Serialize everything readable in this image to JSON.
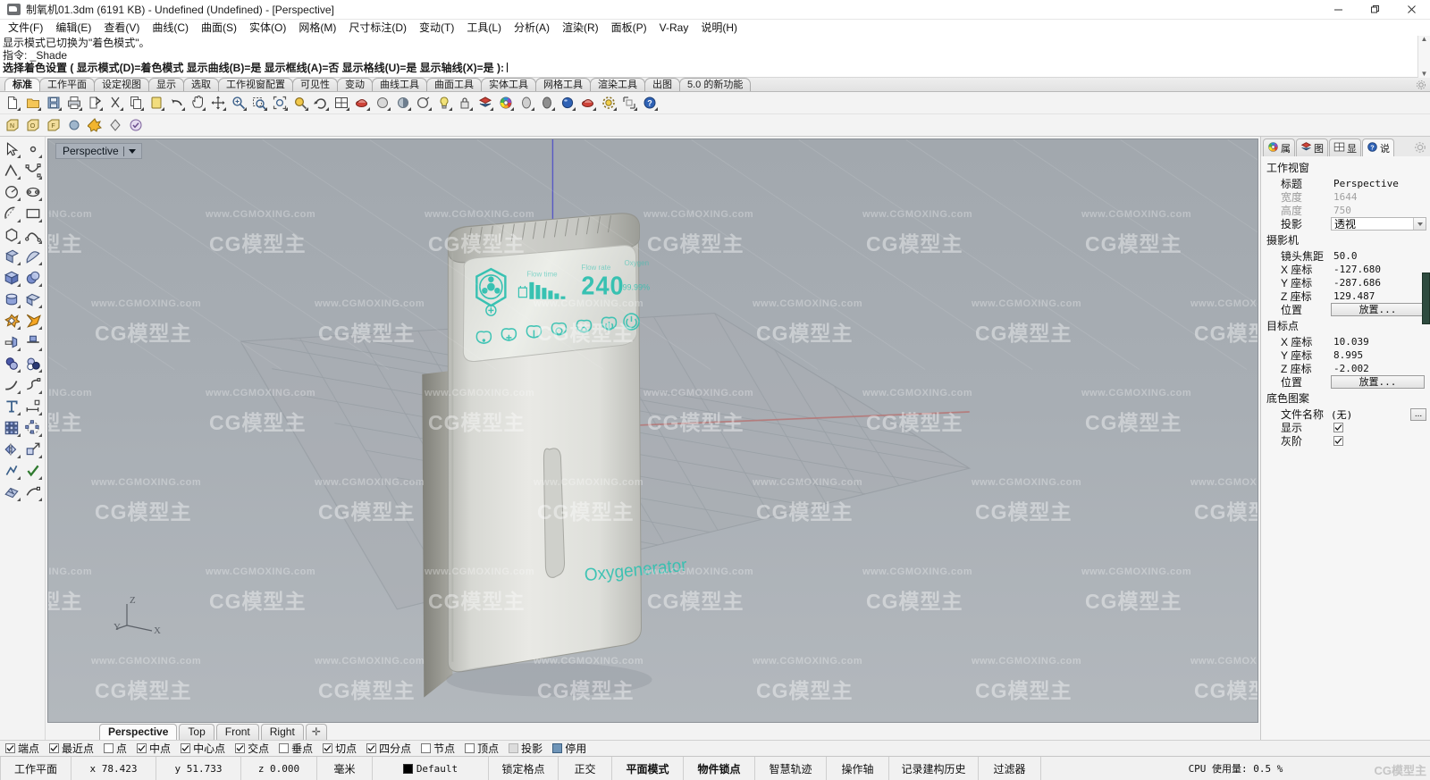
{
  "window": {
    "title": "制氧机01.3dm (6191 KB) - Undefined (Undefined) - [Perspective]",
    "minimize": "—",
    "maximize": "❐",
    "close": "✕"
  },
  "menubar": {
    "items": [
      {
        "label": "文件(F)"
      },
      {
        "label": "编辑(E)"
      },
      {
        "label": "查看(V)"
      },
      {
        "label": "曲线(C)"
      },
      {
        "label": "曲面(S)"
      },
      {
        "label": "实体(O)"
      },
      {
        "label": "网格(M)"
      },
      {
        "label": "尺寸标注(D)"
      },
      {
        "label": "变动(T)"
      },
      {
        "label": "工具(L)"
      },
      {
        "label": "分析(A)"
      },
      {
        "label": "渲染(R)"
      },
      {
        "label": "面板(P)"
      },
      {
        "label": "V-Ray"
      },
      {
        "label": "说明(H)"
      }
    ]
  },
  "command": {
    "history_1": "显示模式已切换为\"着色模式\"。",
    "history_2": "指令: _Shade",
    "prompt": "选择着色设置 ( 显示模式(D)=着色模式  显示曲线(B)=是  显示框线(A)=否  显示格线(U)=是  显示轴线(X)=是 ):",
    "scroll_up": "▲",
    "scroll_down": "▼"
  },
  "toolbar_tabs": {
    "items": [
      {
        "label": "标准",
        "active": true
      },
      {
        "label": "工作平面",
        "active": false
      },
      {
        "label": "设定视图",
        "active": false
      },
      {
        "label": "显示",
        "active": false
      },
      {
        "label": "选取",
        "active": false
      },
      {
        "label": "工作视窗配置",
        "active": false
      },
      {
        "label": "可见性",
        "active": false
      },
      {
        "label": "变动",
        "active": false
      },
      {
        "label": "曲线工具",
        "active": false
      },
      {
        "label": "曲面工具",
        "active": false
      },
      {
        "label": "实体工具",
        "active": false
      },
      {
        "label": "网格工具",
        "active": false
      },
      {
        "label": "渲染工具",
        "active": false
      },
      {
        "label": "出图",
        "active": false
      },
      {
        "label": "5.0 的新功能",
        "active": false
      }
    ]
  },
  "standard_toolbar": {
    "icons": [
      "new-file-icon",
      "open-folder-icon",
      "save-icon",
      "print-icon",
      "export-icon",
      "cut-icon",
      "copy-icon",
      "paste-icon",
      "undo-icon",
      "pan-icon",
      "move-icon",
      "zoom-icon",
      "zoom-window-icon",
      "zoom-extents-icon",
      "zoom-selected-icon",
      "rotate-view-icon",
      "viewport-layout-icon",
      "render-icon",
      "render-preview-icon",
      "shade-icon",
      "properties-icon",
      "light-icon",
      "lock-layer-icon",
      "layer-icon",
      "color-wheel-icon",
      "material-grey-icon",
      "material-dark-icon",
      "material-blue-icon",
      "vray-render-icon",
      "vray-options-icon",
      "vray-frame-icon",
      "help-icon"
    ]
  },
  "secondary_toolbar": {
    "icons": [
      "osnap-n-icon",
      "osnap-o-icon",
      "osnap-f-icon",
      "sphere-icon",
      "explode-icon",
      "diamond-icon",
      "check-circle-icon"
    ]
  },
  "left_palette": {
    "icons": [
      "select-arrow-icon",
      "point-icon",
      "polyline-icon",
      "control-point-curve-icon",
      "circle-icon",
      "ellipse-icon",
      "arc-icon",
      "rectangle-icon",
      "polygon-icon",
      "freeform-curve-icon",
      "surface-from-points-icon",
      "surface-sweep-icon",
      "box-icon",
      "sphere-solid-icon",
      "cylinder-icon",
      "extrude-surface-icon",
      "boolean-union-icon",
      "boolean-difference-icon",
      "trim-icon",
      "split-icon",
      "boolean-sphere-icon",
      "boolean-two-sphere-icon",
      "fillet-curve-icon",
      "blend-curve-icon",
      "text-icon",
      "dimension-icon",
      "array-icon",
      "array-polar-icon",
      "mirror-icon",
      "scale-icon",
      "analyze-icon",
      "check-icon",
      "render-mesh-icon",
      "mesh-tools-icon"
    ]
  },
  "viewport": {
    "label": "Perspective",
    "caret": "▼",
    "axis": {
      "x": "X",
      "y": "Y",
      "z": "Z"
    },
    "model": {
      "brand_text": "Oxygenerator",
      "display_value": "240",
      "display_label_left": "Flow time",
      "display_label_mid": "Flow rate",
      "display_label_right": "Oxygen",
      "display_sub_right": "99.99%",
      "accent_color": "#2fc0b0"
    },
    "tabs": [
      {
        "label": "Perspective",
        "active": true
      },
      {
        "label": "Top",
        "active": false
      },
      {
        "label": "Front",
        "active": false
      },
      {
        "label": "Right",
        "active": false
      },
      {
        "label": "✛",
        "active": false
      }
    ]
  },
  "properties_panel": {
    "tabs": [
      {
        "icon": "color-wheel-icon",
        "label": "属",
        "active": false
      },
      {
        "icon": "layer-icon",
        "label": "图",
        "active": false
      },
      {
        "icon": "display-icon",
        "label": "显",
        "active": false
      },
      {
        "icon": "help-icon",
        "label": "说",
        "active": true
      }
    ],
    "gear_icon": "gear-icon",
    "groups": [
      {
        "title": "工作视窗",
        "rows": [
          {
            "key": "标题",
            "value": "Perspective",
            "type": "text",
            "dim": false
          },
          {
            "key": "宽度",
            "value": "1644",
            "type": "text",
            "dim": true
          },
          {
            "key": "高度",
            "value": "750",
            "type": "text",
            "dim": true
          },
          {
            "key": "投影",
            "value": "透视",
            "type": "combo",
            "dim": false
          }
        ]
      },
      {
        "title": "摄影机",
        "rows": [
          {
            "key": "镜头焦距",
            "value": "50.0",
            "type": "text",
            "dim": false
          },
          {
            "key": "X 座标",
            "value": "-127.680",
            "type": "text",
            "dim": false
          },
          {
            "key": "Y 座标",
            "value": "-287.686",
            "type": "text",
            "dim": false
          },
          {
            "key": "Z 座标",
            "value": "129.487",
            "type": "text",
            "dim": false
          },
          {
            "key": "位置",
            "value": "放置...",
            "type": "button",
            "dim": false
          }
        ]
      },
      {
        "title": "目标点",
        "rows": [
          {
            "key": "X 座标",
            "value": "10.039",
            "type": "text",
            "dim": false
          },
          {
            "key": "Y 座标",
            "value": "8.995",
            "type": "text",
            "dim": false
          },
          {
            "key": "Z 座标",
            "value": "-2.002",
            "type": "text",
            "dim": false
          },
          {
            "key": "位置",
            "value": "放置...",
            "type": "button",
            "dim": false
          }
        ]
      },
      {
        "title": "底色图案",
        "rows": [
          {
            "key": "文件名称",
            "value": "(无)",
            "type": "file",
            "dim": false
          },
          {
            "key": "显示",
            "value": "",
            "type": "checkbox",
            "checked": true,
            "dim": false
          },
          {
            "key": "灰阶",
            "value": "",
            "type": "checkbox",
            "checked": true,
            "dim": false
          }
        ]
      }
    ]
  },
  "osnap_bar": {
    "items": [
      {
        "label": "端点",
        "state": "checked"
      },
      {
        "label": "最近点",
        "state": "checked"
      },
      {
        "label": "点",
        "state": "unchecked"
      },
      {
        "label": "中点",
        "state": "checked"
      },
      {
        "label": "中心点",
        "state": "checked"
      },
      {
        "label": "交点",
        "state": "checked"
      },
      {
        "label": "垂点",
        "state": "unchecked"
      },
      {
        "label": "切点",
        "state": "checked"
      },
      {
        "label": "四分点",
        "state": "checked"
      },
      {
        "label": "节点",
        "state": "unchecked"
      },
      {
        "label": "顶点",
        "state": "unchecked"
      },
      {
        "label": "投影",
        "state": "disabled"
      },
      {
        "label": "停用",
        "state": "filled"
      }
    ]
  },
  "status_bar": {
    "cells": [
      {
        "label": "工作平面",
        "bold": false,
        "mono": false
      },
      {
        "label": "x 78.423",
        "bold": false,
        "mono": true
      },
      {
        "label": "y 51.733",
        "bold": false,
        "mono": true
      },
      {
        "label": "z 0.000",
        "bold": false,
        "mono": true
      },
      {
        "label": "毫米",
        "bold": false,
        "mono": false
      },
      {
        "label": "Default",
        "bold": false,
        "mono": true,
        "swatch": "#000000"
      },
      {
        "label": "锁定格点",
        "bold": false,
        "mono": false
      },
      {
        "label": "正交",
        "bold": false,
        "mono": false
      },
      {
        "label": "平面模式",
        "bold": true,
        "mono": false
      },
      {
        "label": "物件锁点",
        "bold": true,
        "mono": false
      },
      {
        "label": "智慧轨迹",
        "bold": false,
        "mono": false
      },
      {
        "label": "操作轴",
        "bold": false,
        "mono": false
      },
      {
        "label": "记录建构历史",
        "bold": false,
        "mono": false
      },
      {
        "label": "过滤器",
        "bold": false,
        "mono": false
      },
      {
        "label": "CPU 使用量: 0.5 %",
        "bold": false,
        "mono": true
      }
    ]
  },
  "watermark": {
    "text_big": "CG模型主",
    "text_small": "www.CGMOXING.com",
    "corner": "CG模型主"
  }
}
